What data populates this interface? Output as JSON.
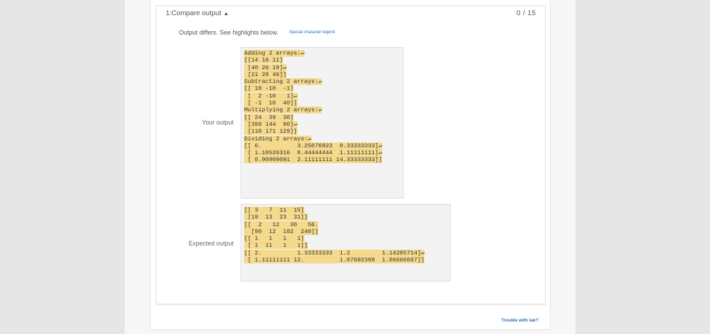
{
  "test": {
    "title": "1:Compare output",
    "score": "0 / 15",
    "differs_text": "Output differs. See highlights below.",
    "legend_link": "Special character legend"
  },
  "your_output": {
    "label": "Your output",
    "lines": [
      "Adding 2 arrays:↵",
      "[[14 16 11]",
      " [40 26 19]↵",
      " [21 28 46]]",
      "Subtracting 2 arrays:↵",
      "[[ 10 -10  -1]",
      " [  2 -10   1]↵",
      " [ -1  10  40]]",
      "Multiplying 2 arrays:↵",
      "[[ 24  39  30]",
      " [399 144  90]↵",
      " [110 171 129]]",
      "Dividing 2 arrays:↵",
      "[[ 6.          3.25076923  0.33333333]↵",
      " [ 1.10526316  0.44444444  1.11111111]↵",
      " [ 0.90909091  2.11111111 14.33333333]]"
    ]
  },
  "expected_output": {
    "label": "Expected output",
    "lines": [
      "[[ 3   7  11  15]",
      " [19  13  23  31]]",
      "[[  2   12   30   56.",
      "  [90  12  182  240]]",
      "[[ 1   1   1   1]",
      " [ 1  11   1   1]]",
      "[[ 2.          1.33333333  1.2         1.14285714]↵",
      " [ 1.11111111 12.          1.07692308  1.06666667]]"
    ]
  },
  "footer": {
    "trouble_link": "Trouble with lab?"
  },
  "colors": {
    "highlight": "#f5d98c",
    "link": "#2e6db4"
  }
}
